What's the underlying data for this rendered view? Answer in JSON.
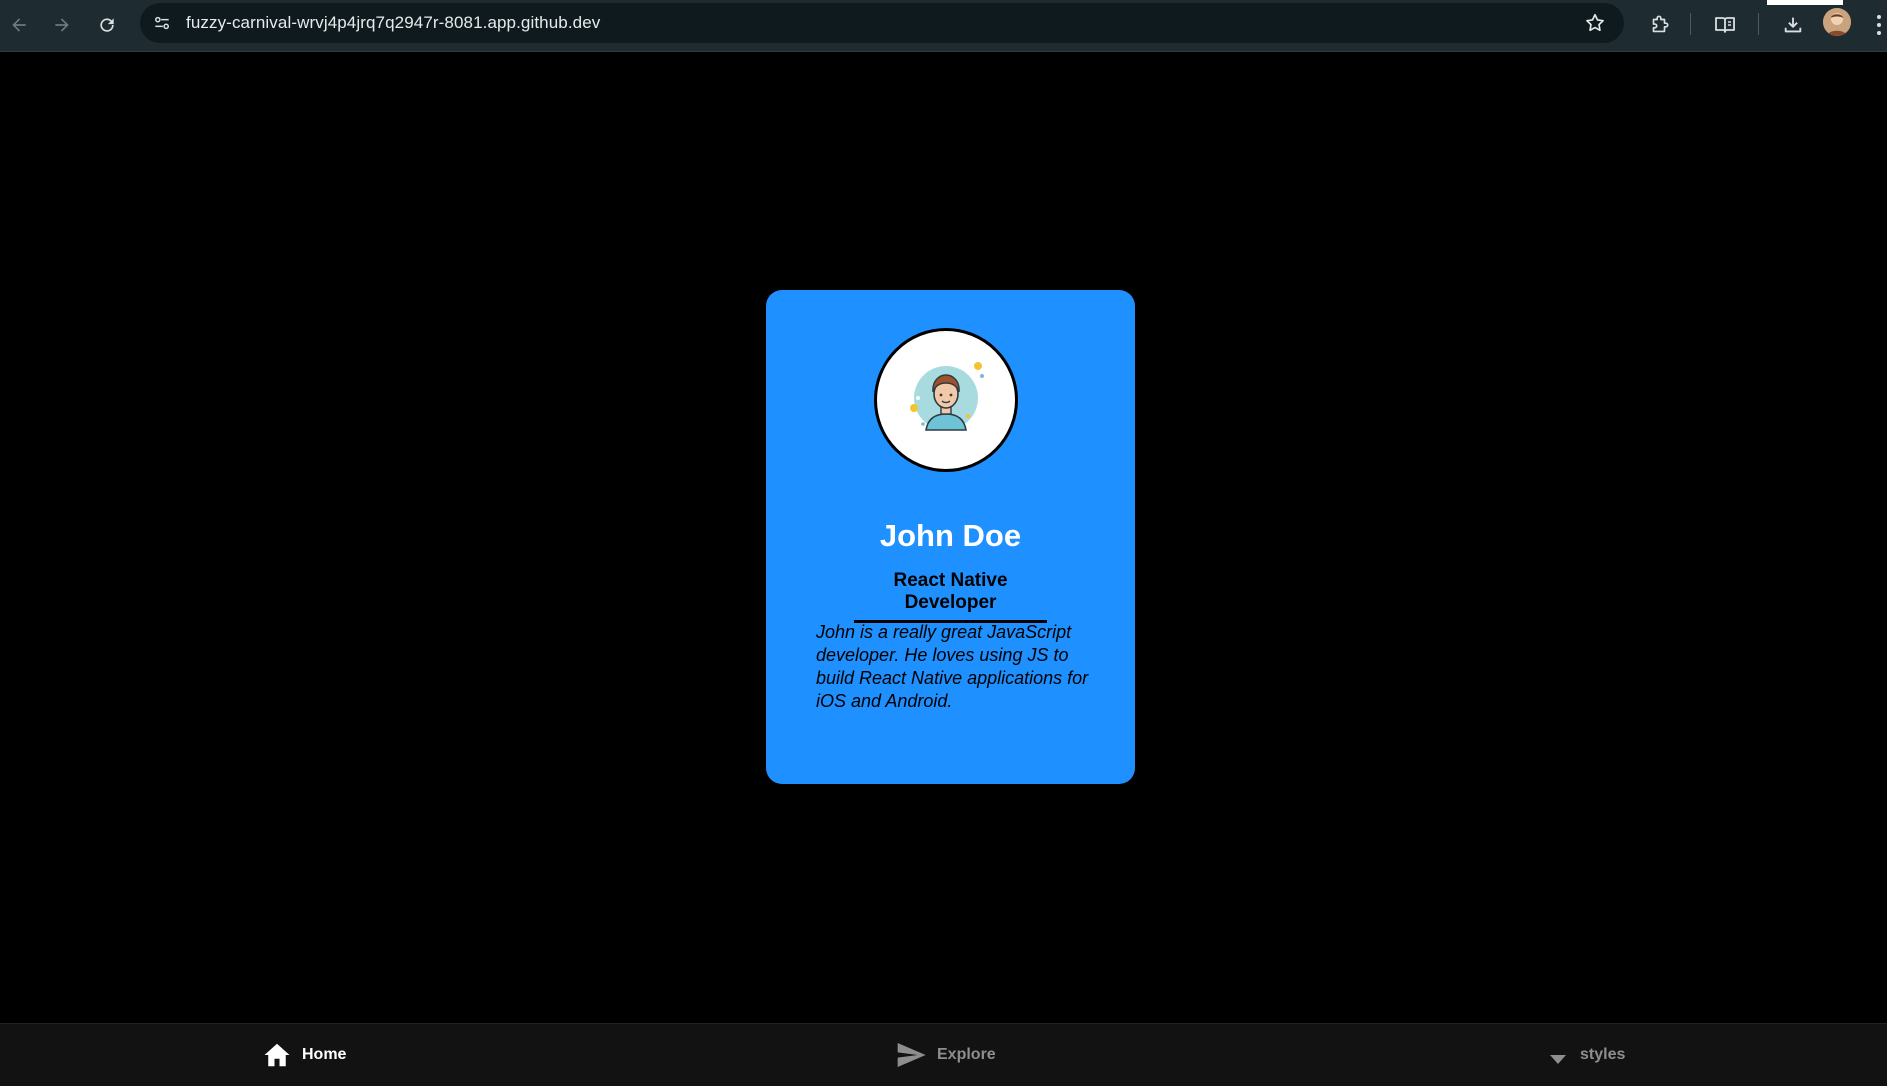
{
  "browser": {
    "url": "fuzzy-carnival-wrvj4p4jrq7q2947r-8081.app.github.dev",
    "icons": [
      "back-arrow-icon",
      "forward-arrow-icon",
      "reload-icon",
      "site-info-icon",
      "bookmark-star-icon",
      "extensions-icon",
      "reading-mode-icon",
      "download-icon",
      "profile-avatar",
      "more-menu-icon"
    ]
  },
  "profile": {
    "name": "John Doe",
    "role": "React Native Developer",
    "bio": "John is a really great JavaScript developer. He loves using JS to build React Native applications for iOS and Android.",
    "avatar_icon": "person-avatar-icon"
  },
  "tabs": [
    {
      "label": "Home",
      "icon": "home-icon",
      "active": true
    },
    {
      "label": "Explore",
      "icon": "send-icon",
      "active": false
    },
    {
      "label": "styles",
      "icon": "caret-down-icon",
      "active": false
    }
  ],
  "colors": {
    "card": "#1e90ff",
    "background": "#000000",
    "tabbar": "#121212",
    "tab_active": "#ffffff",
    "tab_inactive": "#8e8e8e"
  }
}
